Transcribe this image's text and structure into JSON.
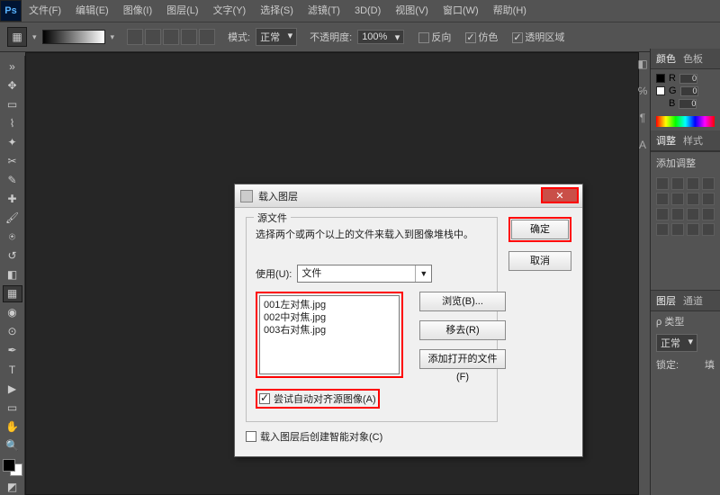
{
  "menu": {
    "items": [
      "文件(F)",
      "编辑(E)",
      "图像(I)",
      "图层(L)",
      "文字(Y)",
      "选择(S)",
      "滤镜(T)",
      "3D(D)",
      "视图(V)",
      "窗口(W)",
      "帮助(H)"
    ],
    "logo": "Ps"
  },
  "optbar": {
    "mode_label": "模式:",
    "mode_value": "正常",
    "opacity_label": "不透明度:",
    "opacity_value": "100%",
    "cb_reverse": "反向",
    "cb_dither": "仿色",
    "cb_transparent": "透明区域"
  },
  "panels": {
    "color_tab": "颜色",
    "swatches_tab": "色板",
    "rgb": {
      "R": "R",
      "G": "G",
      "B": "B",
      "rv": "0",
      "gv": "0",
      "bv": "0"
    },
    "adjust_tab": "调整",
    "styles_tab": "样式",
    "add_adjust": "添加调整",
    "layers_tab": "图层",
    "channels_tab": "通道",
    "kind_label": "ρ 类型",
    "blend_mode": "正常",
    "lock_label": "锁定:",
    "fill_label": "填"
  },
  "dialog": {
    "title": "载入图层",
    "group_title": "源文件",
    "source_desc": "选择两个或两个以上的文件来载入到图像堆栈中。",
    "use_label": "使用(U):",
    "use_value": "文件",
    "files": [
      "001左对焦.jpg",
      "002中对焦.jpg",
      "003右对焦.jpg"
    ],
    "browse": "浏览(B)...",
    "remove": "移去(R)",
    "add_open": "添加打开的文件(F)",
    "auto_align": "尝试自动对齐源图像(A)",
    "smart_obj": "载入图层后创建智能对象(C)",
    "ok": "确定",
    "cancel": "取消",
    "close": "✕"
  },
  "right_icons": [
    "◧",
    "℅",
    "¶",
    "A",
    "□",
    "⌘"
  ]
}
